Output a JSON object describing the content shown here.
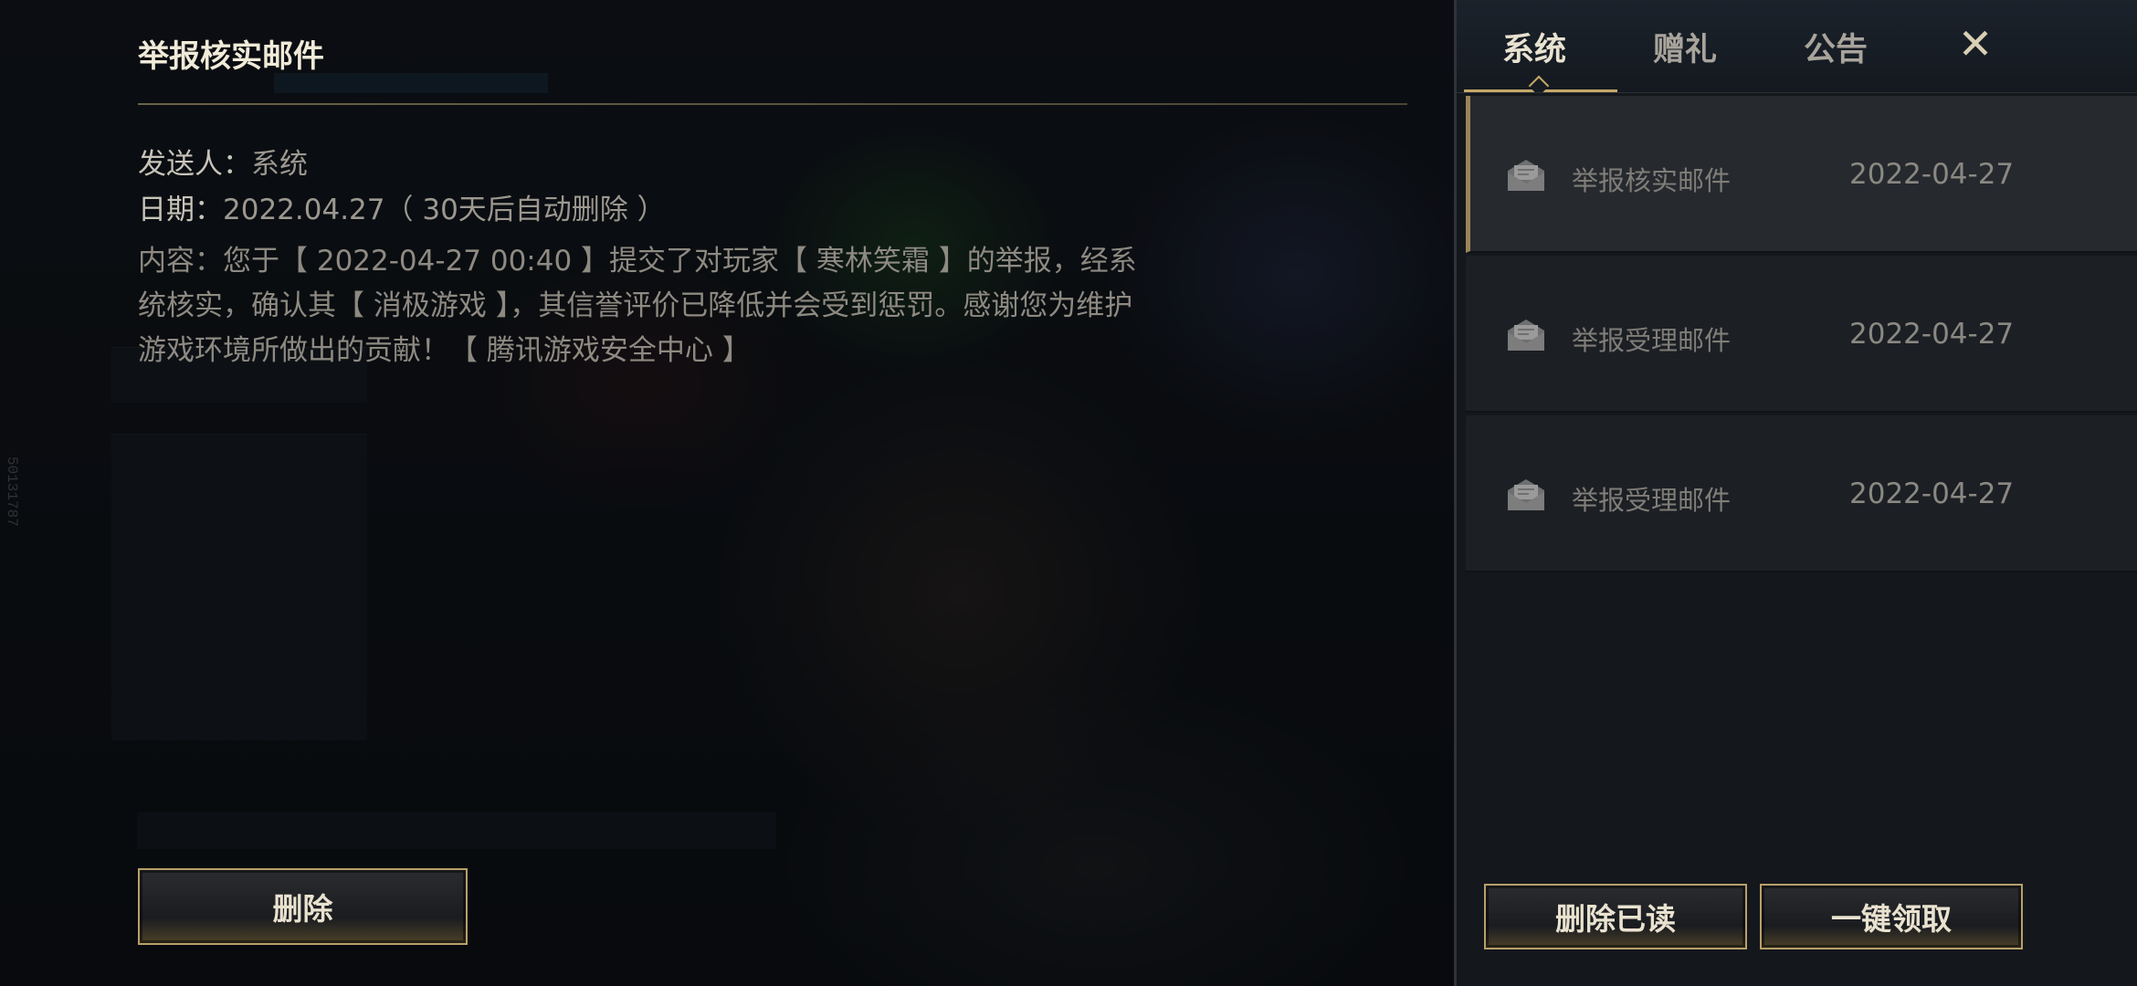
{
  "detail": {
    "title": "举报核实邮件",
    "sender_label": "发送人：",
    "sender_value": "系统",
    "date_label": "日期：",
    "date_value": "2022.04.27（ 30天后自动删除 ）",
    "content": "内容：您于【 2022-04-27 00:40 】提交了对玩家【 寒林笑霜 】的举报，经系统核实，确认其【 消极游戏 】，其信誉评价已降低并会受到惩罚。感谢您为维护游戏环境所做出的贡献！【 腾讯游戏安全中心 】",
    "delete_label": "删除"
  },
  "tabs": [
    {
      "label": "系统",
      "active": true
    },
    {
      "label": "赠礼",
      "active": false
    },
    {
      "label": "公告",
      "active": false
    }
  ],
  "close_label": "✕",
  "mail_list": [
    {
      "subject": "举报核实邮件",
      "date": "2022-04-27",
      "selected": true,
      "icon": "mail-open-icon"
    },
    {
      "subject": "举报受理邮件",
      "date": "2022-04-27",
      "selected": false,
      "icon": "mail-open-icon"
    },
    {
      "subject": "举报受理邮件",
      "date": "2022-04-27",
      "selected": false,
      "icon": "mail-open-icon"
    }
  ],
  "actions": {
    "delete_read_label": "删除已读",
    "claim_all_label": "一键领取"
  },
  "watermark": "50131787",
  "colors": {
    "accent_gold": "#c5a868",
    "panel_bg": "#14171c",
    "selected_item_bg": "#26292e"
  }
}
